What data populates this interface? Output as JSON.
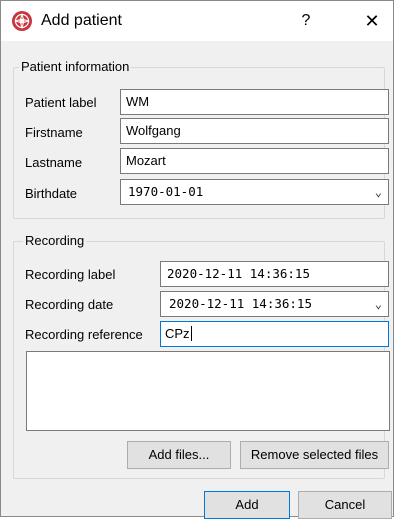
{
  "dialog": {
    "title": "Add patient",
    "help_glyph": "?",
    "close_glyph": "✕",
    "icon": "app-logo-icon",
    "icon_color": "#c8343f"
  },
  "patient": {
    "group_title": "Patient information",
    "label_label": "Patient label",
    "label_value": "WM",
    "firstname_label": "Firstname",
    "firstname_value": "Wolfgang",
    "lastname_label": "Lastname",
    "lastname_value": "Mozart",
    "birthdate_label": "Birthdate",
    "birthdate_value": "1970-01-01"
  },
  "recording": {
    "group_title": "Recording",
    "label_label": "Recording label",
    "label_value": "2020-12-11 14:36:15",
    "date_label": "Recording date",
    "date_value": "2020-12-11 14:36:15",
    "reference_label": "Recording reference",
    "reference_value": "CPz",
    "add_files_label": "Add files...",
    "remove_files_label": "Remove selected files"
  },
  "footer": {
    "add_label": "Add",
    "cancel_label": "Cancel"
  },
  "colors": {
    "focus": "#0078d7",
    "window_bg": "#f0f0f0"
  }
}
